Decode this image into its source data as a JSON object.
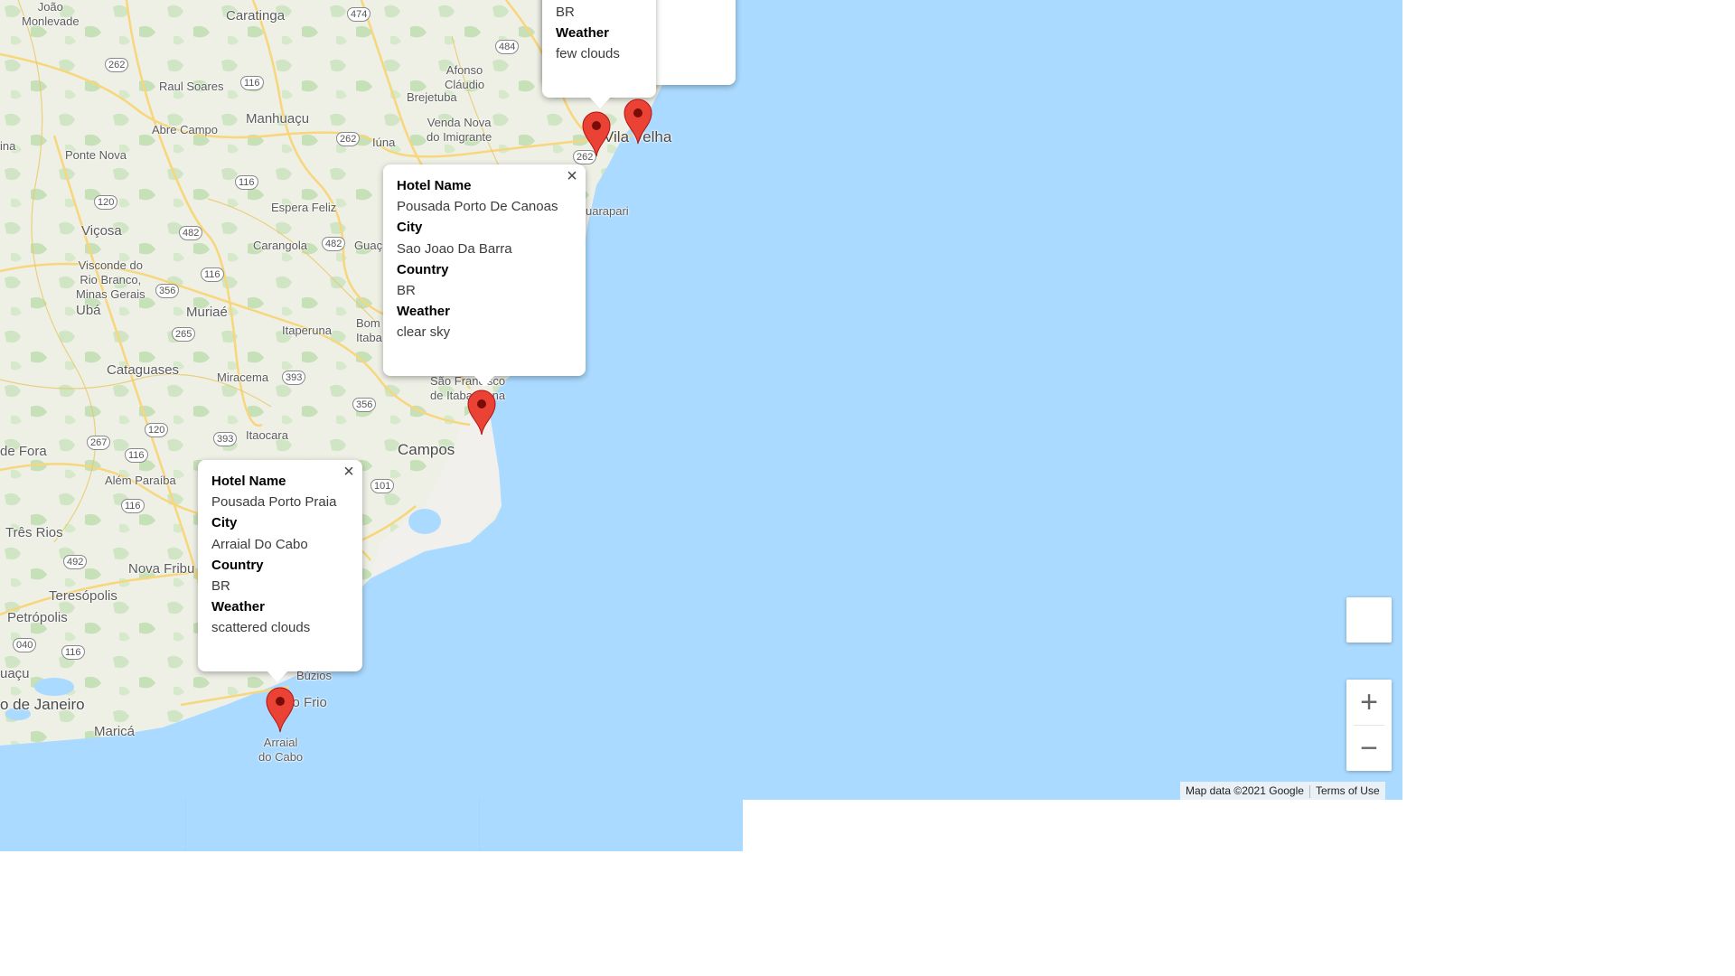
{
  "map": {
    "place_labels": {
      "joao_monlevade": "João\nMonlevade",
      "caratinga": "Caratinga",
      "raul_soares": "Raul Soares",
      "manhuacu": "Manhuaçu",
      "afonso_claudio": "Afonso\nCláudio",
      "brejetuba": "Brejetuba",
      "venda_nova": "Venda Nova\ndo Imigrante",
      "abre_campo": "Abre Campo",
      "iuna": "Iúna",
      "vila_velha": "Vila Velha",
      "ponte_nova": "Ponte Nova",
      "espera_feliz": "Espera Feliz",
      "vicosa": "Viçosa",
      "carangola": "Carangola",
      "guacui": "Guaç",
      "guarapari": "uarapari",
      "visconde_rio_branco": "Visconde do\nRio Branco,\nMinas Gerais",
      "uba": "Ubá",
      "muriae": "Muriaé",
      "itaperuna": "Itaperuna",
      "bom_itabapoana": "Bom\nItaba",
      "cataguases": "Cataguases",
      "miracema": "Miracema",
      "sao_francisco": "São Francisco\nde Itabapoana",
      "itaocara": "Itaocara",
      "campos": "Campos",
      "de_fora": "de Fora",
      "alem_paraiba": "Além Paraíba",
      "tres_rios": "Três Rios",
      "nova_friburgo": "Nova Fribu",
      "teresopolis": "Teresópolis",
      "petropolis": "Petrópolis",
      "buzios": "Búzios",
      "cabo_frio": "Cabo Frio",
      "rio": "o de Janeiro",
      "marica": "Maricá",
      "arraial_label": "Arraial\ndo Cabo",
      "iacu": "uaçu",
      "ina": "ina"
    },
    "road_shields": [
      "474",
      "484",
      "262",
      "116",
      "262",
      "116",
      "120",
      "482",
      "482",
      "116",
      "356",
      "265",
      "393",
      "356",
      "120",
      "393",
      "267",
      "116",
      "101",
      "116",
      "492",
      "040",
      "116",
      "262"
    ],
    "markers": [
      {
        "name": "Vitoria marker",
        "color": "#ea4335"
      },
      {
        "name": "Vila Velha marker",
        "color": "#ea4335"
      },
      {
        "name": "Sao Joao Da Barra marker",
        "color": "#ea4335"
      },
      {
        "name": "Arraial Do Cabo marker",
        "color": "#ea4335"
      }
    ],
    "popups": [
      {
        "id": "top",
        "country_value": "BR",
        "weather_label": "Weather",
        "weather_value": "few clouds"
      },
      {
        "id": "sao-joao",
        "hotel_label": "Hotel Name",
        "hotel_value": "Pousada Porto De Canoas",
        "city_label": "City",
        "city_value": "Sao Joao Da Barra",
        "country_label": "Country",
        "country_value": "BR",
        "weather_label": "Weather",
        "weather_value": "clear sky",
        "close": "×"
      },
      {
        "id": "arraial",
        "hotel_label": "Hotel Name",
        "hotel_value": "Pousada Porto Praia",
        "city_label": "City",
        "city_value": "Arraial Do Cabo",
        "country_label": "Country",
        "country_value": "BR",
        "weather_label": "Weather",
        "weather_value": "scattered clouds",
        "close": "×"
      }
    ],
    "zoom_in": "+",
    "zoom_out": "−",
    "attribution": "Map data ©2021 Google",
    "terms": "Terms of Use",
    "colors": {
      "water": "#aadaff",
      "land": "#f1f0ec",
      "vegetation": "#d2e7c8",
      "road": "#f7d67c",
      "marker": "#ea4335"
    }
  }
}
